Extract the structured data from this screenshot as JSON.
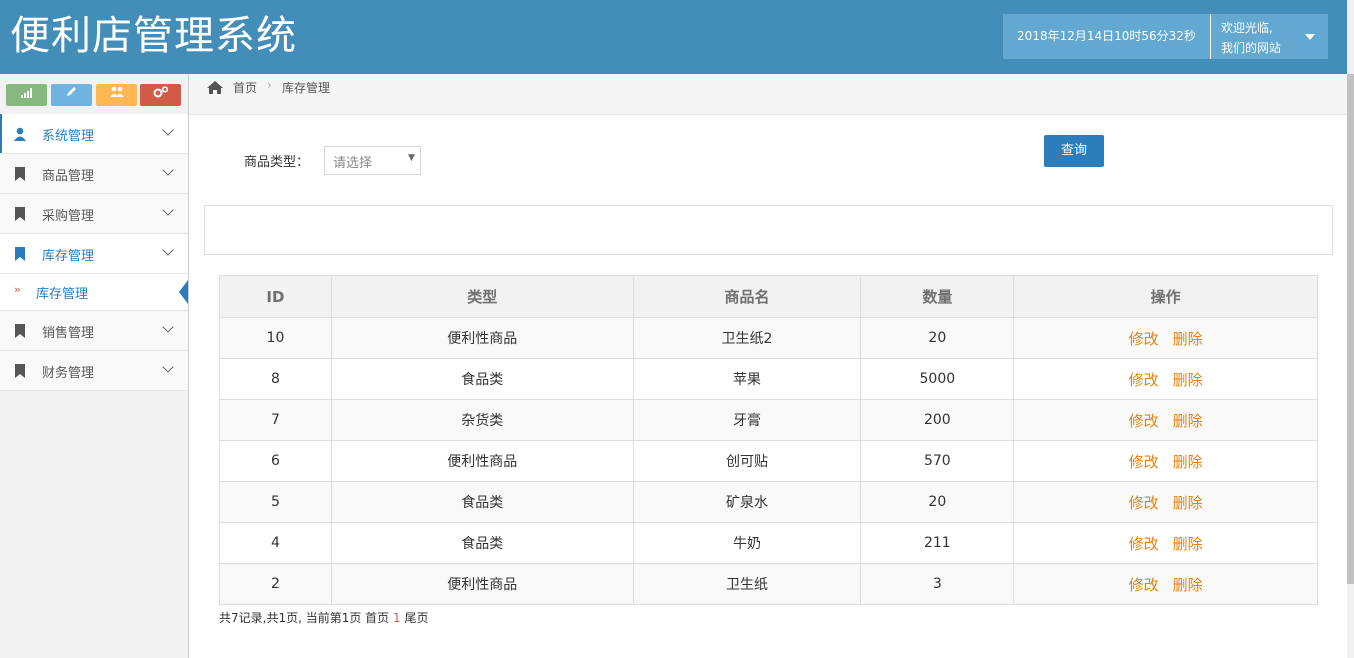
{
  "header": {
    "title": "便利店管理系统",
    "datetime": "2018年12月14日10时56分32秒",
    "welcome_line1": "欢迎光临,",
    "welcome_line2": "我们的网站"
  },
  "sidebar": {
    "shortcut_colors": [
      "#87b87f",
      "#6fb3e0",
      "#ffb752",
      "#d15b47"
    ],
    "items": [
      {
        "label": "系统管理",
        "icon": "user-icon"
      },
      {
        "label": "商品管理",
        "icon": "bookmark-icon"
      },
      {
        "label": "采购管理",
        "icon": "bookmark-icon"
      },
      {
        "label": "库存管理",
        "icon": "bookmark-icon"
      },
      {
        "label": "销售管理",
        "icon": "bookmark-icon"
      },
      {
        "label": "财务管理",
        "icon": "bookmark-icon"
      }
    ],
    "sub_item": "库存管理"
  },
  "breadcrumb": {
    "home": "首页",
    "current": "库存管理"
  },
  "filter": {
    "label": "商品类型：",
    "select_value": "请选择",
    "query_button": "查询"
  },
  "table": {
    "headers": [
      "ID",
      "类型",
      "商品名",
      "数量",
      "操作"
    ],
    "rows": [
      {
        "id": "10",
        "type": "便利性商品",
        "name": "卫生纸2",
        "qty": "20"
      },
      {
        "id": "8",
        "type": "食品类",
        "name": "苹果",
        "qty": "5000"
      },
      {
        "id": "7",
        "type": "杂货类",
        "name": "牙膏",
        "qty": "200"
      },
      {
        "id": "6",
        "type": "便利性商品",
        "name": "创可贴",
        "qty": "570"
      },
      {
        "id": "5",
        "type": "食品类",
        "name": "矿泉水",
        "qty": "20"
      },
      {
        "id": "4",
        "type": "食品类",
        "name": "牛奶",
        "qty": "211"
      },
      {
        "id": "2",
        "type": "便利性商品",
        "name": "卫生纸",
        "qty": "3"
      }
    ],
    "edit_label": "修改",
    "delete_label": "删除"
  },
  "pager": {
    "summary": "共7记录,共1页, 当前第1页 首页",
    "current_page": "1",
    "last": "尾页"
  }
}
